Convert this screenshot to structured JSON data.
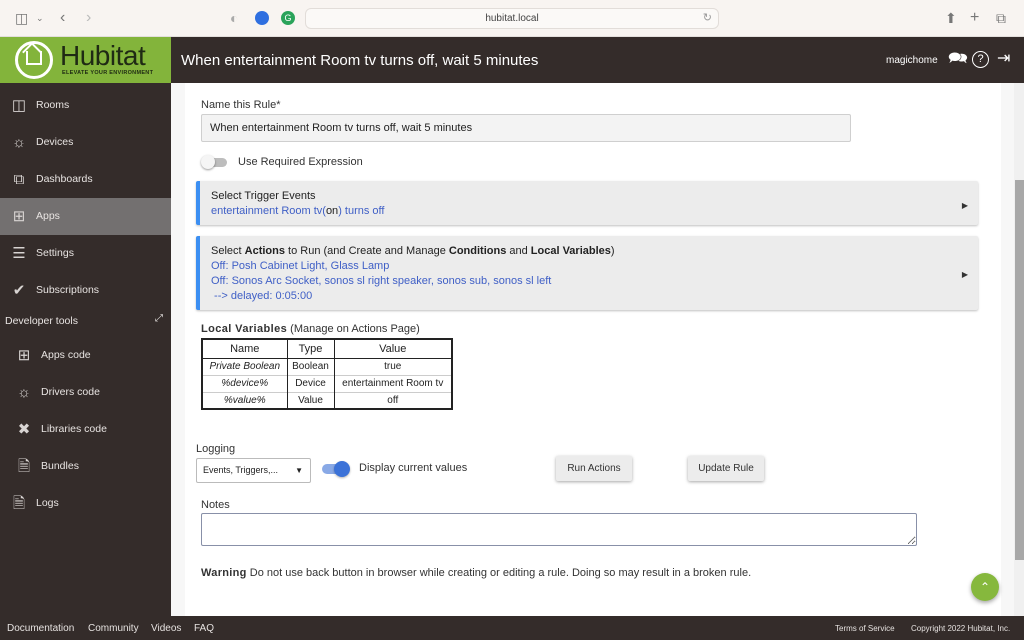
{
  "browser": {
    "url": "hubitat.local",
    "icons": [
      "sidebar-toggle-icon",
      "chevron-down-icon",
      "back-icon",
      "forward-icon",
      "shield-icon",
      "globe-icon",
      "grammarly-icon",
      "reload-icon",
      "share-icon",
      "new-tab-icon",
      "tabs-icon"
    ]
  },
  "header": {
    "logo_text": "Hubitat",
    "logo_tagline": "ELEVATE YOUR ENVIRONMENT",
    "title": "When entertainment Room tv turns off, wait 5 minutes",
    "username": "magichome",
    "icons": [
      "chat-icon",
      "help-icon",
      "logout-icon"
    ]
  },
  "sidebar": {
    "items": [
      {
        "label": "Rooms",
        "icon": "rooms-icon"
      },
      {
        "label": "Devices",
        "icon": "lightbulb-icon"
      },
      {
        "label": "Dashboards",
        "icon": "dashboards-icon"
      },
      {
        "label": "Apps",
        "icon": "apps-icon",
        "active": true
      },
      {
        "label": "Settings",
        "icon": "sliders-icon"
      },
      {
        "label": "Subscriptions",
        "icon": "check-circle-icon"
      }
    ],
    "devtools_label": "Developer tools",
    "devtools_items": [
      {
        "label": "Apps code",
        "icon": "apps-icon"
      },
      {
        "label": "Drivers code",
        "icon": "lightbulb-icon"
      },
      {
        "label": "Libraries code",
        "icon": "tools-icon"
      },
      {
        "label": "Bundles",
        "icon": "zip-file-icon"
      }
    ],
    "logs_label": "Logs"
  },
  "form": {
    "name_label": "Name this Rule*",
    "name_value": "When entertainment Room tv turns off, wait 5 minutes",
    "required_expression_label": "Use Required Expression",
    "required_expression_on": false,
    "trigger": {
      "title": "Select Trigger Events",
      "line_pre": "entertainment Room tv(",
      "line_state": "on",
      "line_post": ") turns off"
    },
    "actions": {
      "title_parts": [
        "Select ",
        "Actions",
        " to Run (and Create and Manage ",
        "Conditions",
        " and ",
        "Local Variables",
        ")"
      ],
      "lines": [
        "Off: Posh Cabinet Light, Glass Lamp",
        "Off: Sonos Arc Socket, sonos sl right speaker, sonos sub, sonos sl left",
        " --> delayed: 0:05:00"
      ]
    },
    "local_variables": {
      "title": "Local Variables",
      "subtitle": " (Manage on Actions Page)",
      "columns": [
        "Name",
        "Type",
        "Value"
      ],
      "rows": [
        {
          "name": "Private Boolean",
          "type": "Boolean",
          "value": "true"
        },
        {
          "name": "%device%",
          "type": "Device",
          "value": "entertainment Room tv"
        },
        {
          "name": "%value%",
          "type": "Value",
          "value": "off"
        }
      ]
    },
    "logging_label": "Logging",
    "logging_value": "Events, Triggers,...",
    "display_values_label": "Display current values",
    "display_values_on": true,
    "run_actions_label": "Run Actions",
    "update_rule_label": "Update Rule",
    "notes_label": "Notes",
    "notes_value": "",
    "warning_bold": "Warning",
    "warning_text": " Do not use back button in browser while creating or editing a rule. Doing so may result in a broken rule."
  },
  "footer": {
    "links": [
      "Documentation",
      "Community",
      "Videos",
      "FAQ"
    ],
    "terms": "Terms of Service",
    "copyright": "Copyright 2022 Hubitat, Inc."
  },
  "colors": {
    "brand_green": "#83b43b",
    "header_dark": "#342c2a",
    "accent_blue": "#3c8ff2",
    "link_blue": "#3f5fc6"
  }
}
